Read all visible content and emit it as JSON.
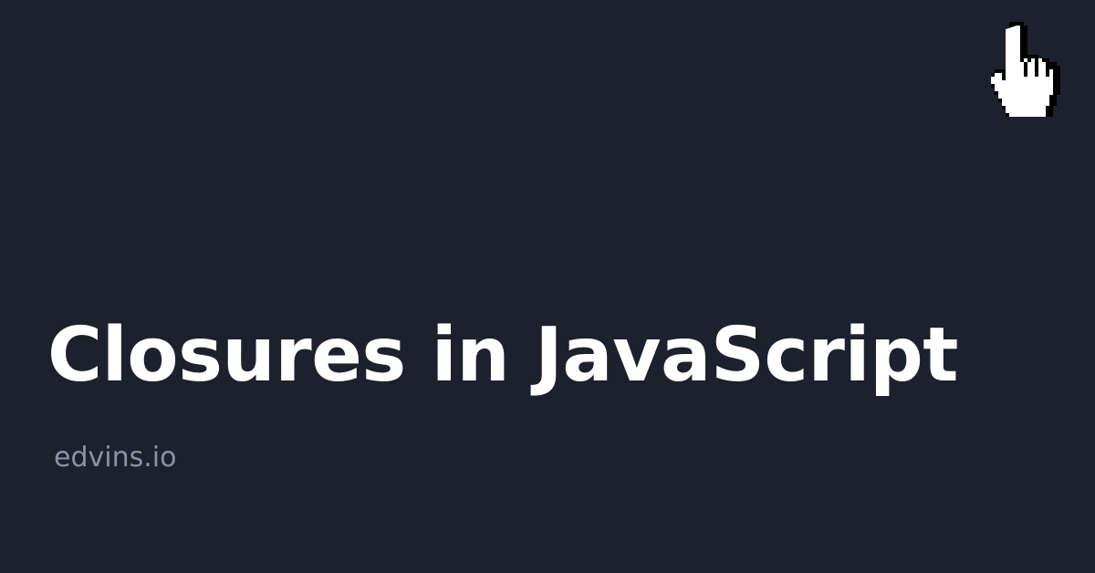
{
  "title": "Closures in JavaScript",
  "site": "edvins.io",
  "cursor_icon": "hand-pointer-icon",
  "colors": {
    "background": "#1c212d",
    "title": "#ffffff",
    "site": "#8a92a6"
  }
}
